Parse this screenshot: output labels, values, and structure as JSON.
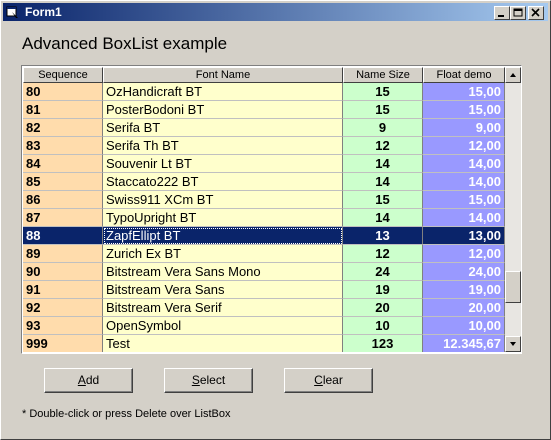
{
  "window": {
    "title": "Form1"
  },
  "heading": "Advanced BoxList example",
  "grid": {
    "columns": [
      "Sequence",
      "Font Name",
      "Name Size",
      "Float demo"
    ],
    "rows": [
      [
        "80",
        "OzHandicraft BT",
        "15",
        "15,00"
      ],
      [
        "81",
        "PosterBodoni BT",
        "15",
        "15,00"
      ],
      [
        "82",
        "Serifa BT",
        "9",
        "9,00"
      ],
      [
        "83",
        "Serifa Th BT",
        "12",
        "12,00"
      ],
      [
        "84",
        "Souvenir Lt BT",
        "14",
        "14,00"
      ],
      [
        "85",
        "Staccato222 BT",
        "14",
        "14,00"
      ],
      [
        "86",
        "Swiss911 XCm BT",
        "15",
        "15,00"
      ],
      [
        "87",
        "TypoUpright BT",
        "14",
        "14,00"
      ],
      [
        "88",
        "ZapfEllipt BT",
        "13",
        "13,00"
      ],
      [
        "89",
        "Zurich Ex BT",
        "12",
        "12,00"
      ],
      [
        "90",
        "Bitstream Vera Sans Mono",
        "24",
        "24,00"
      ],
      [
        "91",
        "Bitstream Vera Sans",
        "19",
        "19,00"
      ],
      [
        "92",
        "Bitstream Vera Serif",
        "20",
        "20,00"
      ],
      [
        "93",
        "OpenSymbol",
        "10",
        "10,00"
      ],
      [
        "999",
        "Test",
        "123",
        "12.345,67"
      ]
    ],
    "selected_index": 8
  },
  "buttons": {
    "add": {
      "underline": "A",
      "rest": "dd"
    },
    "select": {
      "underline": "S",
      "rest": "elect"
    },
    "clear": {
      "underline": "C",
      "rest": "lear"
    }
  },
  "note": "* Double-click or press Delete  over ListBox",
  "colors": {
    "seq_bg": "#ffdcac",
    "font_bg": "#ffffcc",
    "size_bg": "#ccffcc",
    "float_bg": "#9999ff",
    "selection": "#0a246a"
  }
}
